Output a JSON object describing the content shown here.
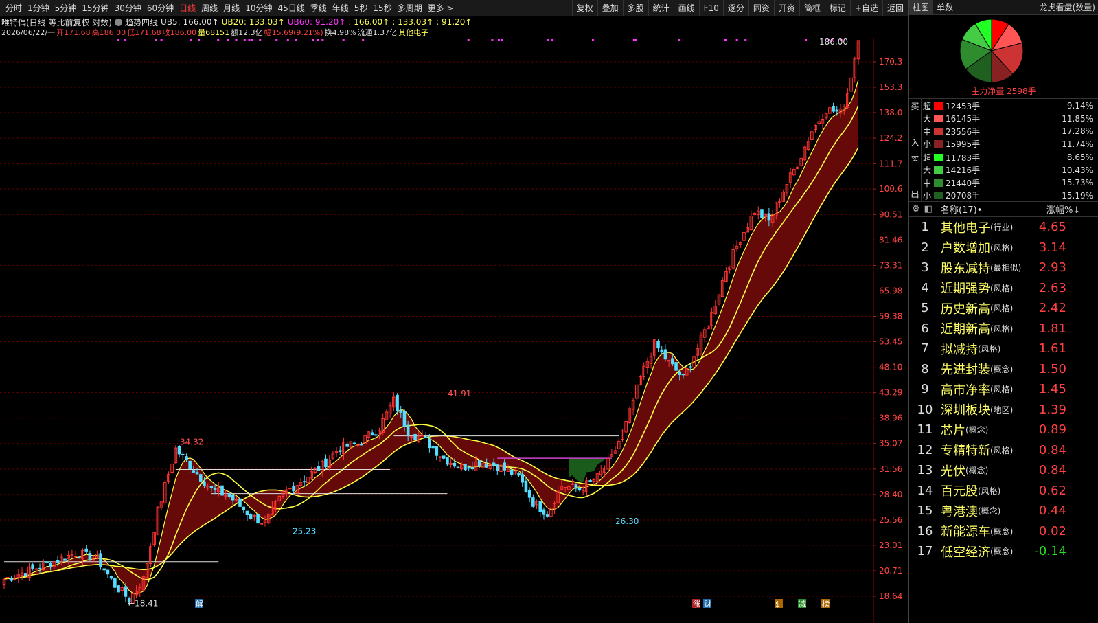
{
  "toolbar": {
    "periods": [
      "分时",
      "1分钟",
      "5分钟",
      "15分钟",
      "30分钟",
      "60分钟",
      "日线",
      "周线",
      "月线",
      "10分钟",
      "45日线",
      "季线",
      "年线",
      "5秒",
      "15秒",
      "多周期",
      "更多 >"
    ],
    "active_period": "日线",
    "buttons": [
      "复权",
      "叠加",
      "多股",
      "统计",
      "画线",
      "F10",
      "逐分",
      "同资",
      "开资",
      "简框",
      "标记",
      "+自选",
      "返回"
    ]
  },
  "info_line1": {
    "stock": "唯特偶(日线 等比前复权 对数)",
    "indicator": "趋势四线",
    "ub5": "UB5: 166.00↑",
    "ub20": "UB20: 133.03↑",
    "ub60": "UB60: 91.20↑",
    "v1": ": 166.00↑",
    "v2": ": 133.03↑",
    "v3": ": 91.20↑"
  },
  "info_line2": {
    "date": "2026/06/22/一",
    "open": "开171.68",
    "high": "高186.00",
    "low": "低171.68",
    "close": "收186.00",
    "vol": "量68151",
    "amount": "额12.3亿",
    "change": "幅15.69(9.21%)",
    "turnover": "换4.98%",
    "float": "流通1.37亿",
    "sector": "其他电子"
  },
  "chart_data": {
    "type": "candlestick",
    "y_axis_scale": "log",
    "y_ticks": [
      "170.3",
      "153.3",
      "138.0",
      "124.2",
      "111.7",
      "100.6",
      "90.51",
      "81.46",
      "73.31",
      "65.98",
      "59.38",
      "53.45",
      "48.10",
      "43.29",
      "38.96",
      "35.07",
      "31.56",
      "28.40",
      "25.56",
      "23.01",
      "20.71",
      "18.64"
    ],
    "annotations": [
      "186.00",
      "41.91",
      "34.32",
      "25.23",
      "26.30",
      "18.41"
    ],
    "bottom_markers": [
      "解",
      "涨",
      "财",
      "$",
      "减",
      "榜"
    ],
    "colors": {
      "up": "#ff3333",
      "down": "#55ddff",
      "band_up": "#6a0a0a",
      "band_down": "#1a5a1a",
      "line": "#ffff44",
      "magenta": "#cc44cc"
    }
  },
  "side": {
    "tabs": [
      "柱图",
      "单数"
    ],
    "title": "龙虎看盘(数量)",
    "net_label": "主力净量 2598手",
    "buy_side": [
      "买",
      "入"
    ],
    "sell_side": [
      "卖",
      "出"
    ],
    "buy": [
      {
        "size": "超",
        "qty": "12453手",
        "pct": "9.14%",
        "color": "#ff0000"
      },
      {
        "size": "大",
        "qty": "16145手",
        "pct": "11.85%",
        "color": "#ff5555"
      },
      {
        "size": "中",
        "qty": "23556手",
        "pct": "17.28%",
        "color": "#cc3333"
      },
      {
        "size": "小",
        "qty": "15995手",
        "pct": "11.74%",
        "color": "#882222"
      }
    ],
    "sell": [
      {
        "size": "超",
        "qty": "11783手",
        "pct": "8.65%",
        "color": "#22ff22"
      },
      {
        "size": "大",
        "qty": "14216手",
        "pct": "10.43%",
        "color": "#44cc44"
      },
      {
        "size": "中",
        "qty": "21440手",
        "pct": "15.73%",
        "color": "#2e8b2e"
      },
      {
        "size": "小",
        "qty": "20708手",
        "pct": "15.19%",
        "color": "#1f5f1f"
      }
    ],
    "list_header": {
      "name": "名称(17)•",
      "pct": "涨幅%↓"
    },
    "list": [
      {
        "idx": "1",
        "name": "其他电子",
        "tag": "(行业)",
        "pct": "4.65",
        "up": true
      },
      {
        "idx": "2",
        "name": "户数增加",
        "tag": "(风格)",
        "pct": "3.14",
        "up": true
      },
      {
        "idx": "3",
        "name": "股东减持",
        "tag": "(最相似)",
        "pct": "2.93",
        "up": true
      },
      {
        "idx": "4",
        "name": "近期强势",
        "tag": "(风格)",
        "pct": "2.63",
        "up": true
      },
      {
        "idx": "5",
        "name": "历史新高",
        "tag": "(风格)",
        "pct": "2.42",
        "up": true
      },
      {
        "idx": "6",
        "name": "近期新高",
        "tag": "(风格)",
        "pct": "1.81",
        "up": true
      },
      {
        "idx": "7",
        "name": "拟减持",
        "tag": "(风格)",
        "pct": "1.61",
        "up": true
      },
      {
        "idx": "8",
        "name": "先进封装",
        "tag": "(概念)",
        "pct": "1.50",
        "up": true
      },
      {
        "idx": "9",
        "name": "高市净率",
        "tag": "(风格)",
        "pct": "1.45",
        "up": true
      },
      {
        "idx": "10",
        "name": "深圳板块",
        "tag": "(地区)",
        "pct": "1.39",
        "up": true
      },
      {
        "idx": "11",
        "name": "芯片",
        "tag": "(概念)",
        "pct": "0.89",
        "up": true
      },
      {
        "idx": "12",
        "name": "专精特新",
        "tag": "(风格)",
        "pct": "0.84",
        "up": true
      },
      {
        "idx": "13",
        "name": "光伏",
        "tag": "(概念)",
        "pct": "0.84",
        "up": true
      },
      {
        "idx": "14",
        "name": "百元股",
        "tag": "(风格)",
        "pct": "0.62",
        "up": true
      },
      {
        "idx": "15",
        "name": "粤港澳",
        "tag": "(概念)",
        "pct": "0.44",
        "up": true
      },
      {
        "idx": "16",
        "name": "新能源车",
        "tag": "(概念)",
        "pct": "0.02",
        "up": true
      },
      {
        "idx": "17",
        "name": "低空经济",
        "tag": "(概念)",
        "pct": "-0.14",
        "up": false
      }
    ]
  }
}
